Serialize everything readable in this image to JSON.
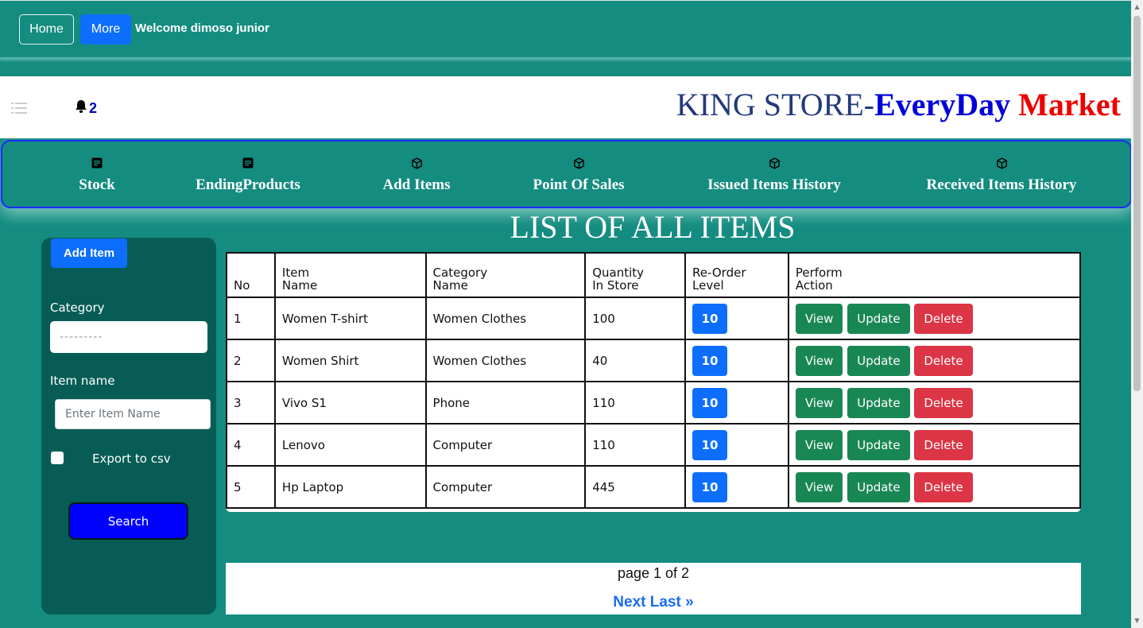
{
  "topnav": {
    "home_label": "Home",
    "more_label": "More",
    "welcome_text": "Welcome dimoso junior"
  },
  "header": {
    "notification_count": "2",
    "brand_part1": "KING STORE-",
    "brand_part2": "EveryDay",
    "brand_part3": "Market"
  },
  "nav": {
    "items": [
      {
        "label": "Stock",
        "icon": "document-icon"
      },
      {
        "label": "EndingProducts",
        "icon": "document-icon"
      },
      {
        "label": "Add Items",
        "icon": "box-icon"
      },
      {
        "label": "Point Of Sales",
        "icon": "box-icon"
      },
      {
        "label": "Issued Items History",
        "icon": "box-icon"
      },
      {
        "label": "Received Items History",
        "icon": "box-icon"
      }
    ]
  },
  "page_title": "LIST OF ALL ITEMS",
  "sidebar": {
    "add_item_label": "Add Item",
    "category_label": "Category",
    "category_value": "---------",
    "item_name_label": "Item name",
    "item_name_placeholder": "Enter Item Name",
    "export_label": "Export to csv",
    "search_label": "Search"
  },
  "table": {
    "headers": [
      {
        "line1": "",
        "line2": "No"
      },
      {
        "line1": "Item",
        "line2": "Name"
      },
      {
        "line1": "Category",
        "line2": "Name"
      },
      {
        "line1": "Quantity",
        "line2": "In Store"
      },
      {
        "line1": "Re-Order",
        "line2": "Level"
      },
      {
        "line1": "Perform",
        "line2": "Action"
      }
    ],
    "rows": [
      {
        "no": "1",
        "name": "Women T-shirt",
        "category": "Women Clothes",
        "quantity": "100",
        "reorder": "10"
      },
      {
        "no": "2",
        "name": "Women Shirt",
        "category": "Women Clothes",
        "quantity": "40",
        "reorder": "10"
      },
      {
        "no": "3",
        "name": "Vivo S1",
        "category": "Phone",
        "quantity": "110",
        "reorder": "10"
      },
      {
        "no": "4",
        "name": "Lenovo",
        "category": "Computer",
        "quantity": "110",
        "reorder": "10"
      },
      {
        "no": "5",
        "name": "Hp Laptop",
        "category": "Computer",
        "quantity": "445",
        "reorder": "10"
      }
    ],
    "actions": {
      "view": "View",
      "update": "Update",
      "delete": "Delete"
    }
  },
  "pagination": {
    "status": "page 1 of 2",
    "next_label": "Next",
    "last_label": "Last »"
  },
  "colors": {
    "background": "#148c80",
    "sidebar": "#075d55",
    "primary": "#0d6efd",
    "success": "#198754",
    "danger": "#dc3545",
    "brand_blue": "#0000d8",
    "brand_red": "#ee0000"
  }
}
